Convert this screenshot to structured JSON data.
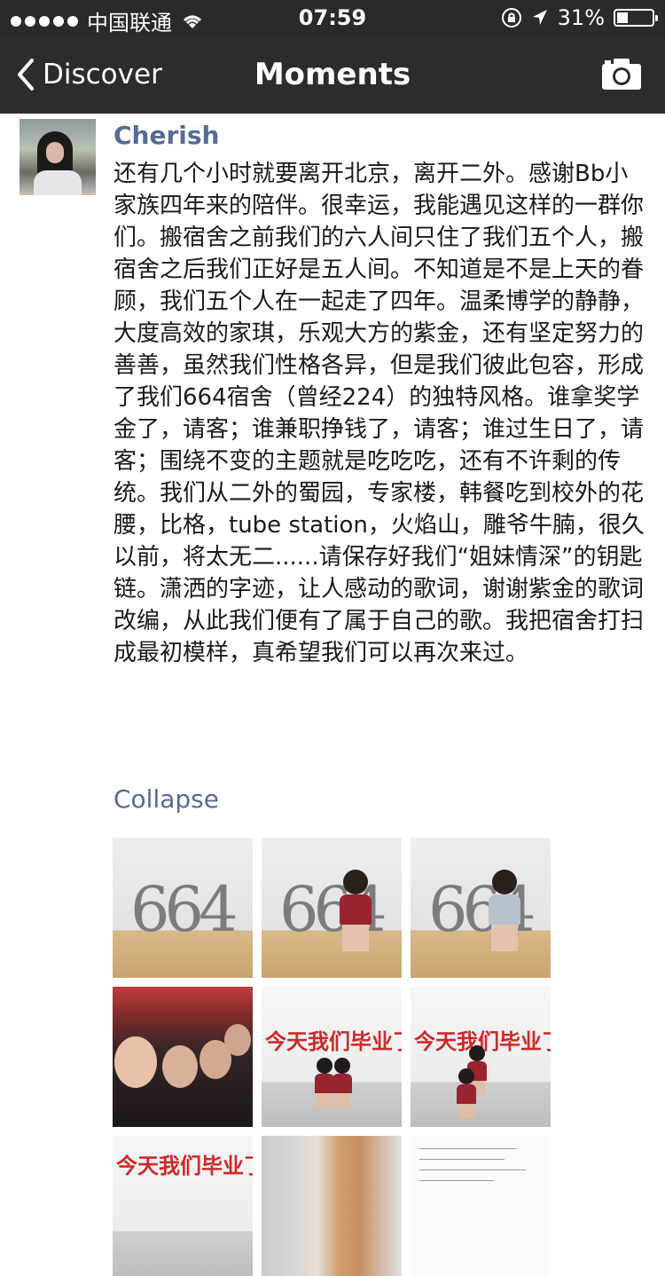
{
  "status_bar": {
    "carrier": "中国联通",
    "time": "07:59",
    "battery": "31%",
    "battery_level": 0.31,
    "icons": [
      "signal-dots-icon",
      "wifi-icon",
      "rotation-lock-icon",
      "location-arrow-icon",
      "battery-icon"
    ]
  },
  "nav": {
    "back_label": "Discover",
    "title": "Moments",
    "right_icon": "camera-icon"
  },
  "post": {
    "author": "Cherish",
    "text": "还有几个小时就要离开北京，离开二外。感谢Bb小家族四年来的陪伴。很幸运，我能遇见这样的一群你们。搬宿舍之前我们的六人间只住了我们五个人，搬宿舍之后我们正好是五人间。不知道是不是上天的眷顾，我们五个人在一起走了四年。温柔博学的静静，大度高效的家琪，乐观大方的紫金，还有坚定努力的善善，虽然我们性格各异，但是我们彼此包容，形成了我们664宿舍（曾经224）的独特风格。谁拿奖学金了，请客；谁兼职挣钱了，请客；谁过生日了，请客；围绕不变的主题就是吃吃吃，还有不许剩的传统。我们从二外的蜀园，专家楼，韩餐吃到校外的花腰，比格，tube station，火焰山，雕爷牛腩，很久以前，将太无二......请保存好我们“姐妹情深”的钥匙链。潇洒的字迹，让人感动的歌词，谢谢紫金的歌词改编，从此我们便有了属于自己的歌。我把宿舍打扫成最初模样，真希望我们可以再次来过。",
    "collapse_label": "Collapse",
    "photo_wall_number": "664",
    "banner_text": "今天我们毕业了"
  },
  "colors": {
    "nav_background": "#2c2c30",
    "link_blue": "#576b95",
    "text": "#1a1a1a"
  }
}
